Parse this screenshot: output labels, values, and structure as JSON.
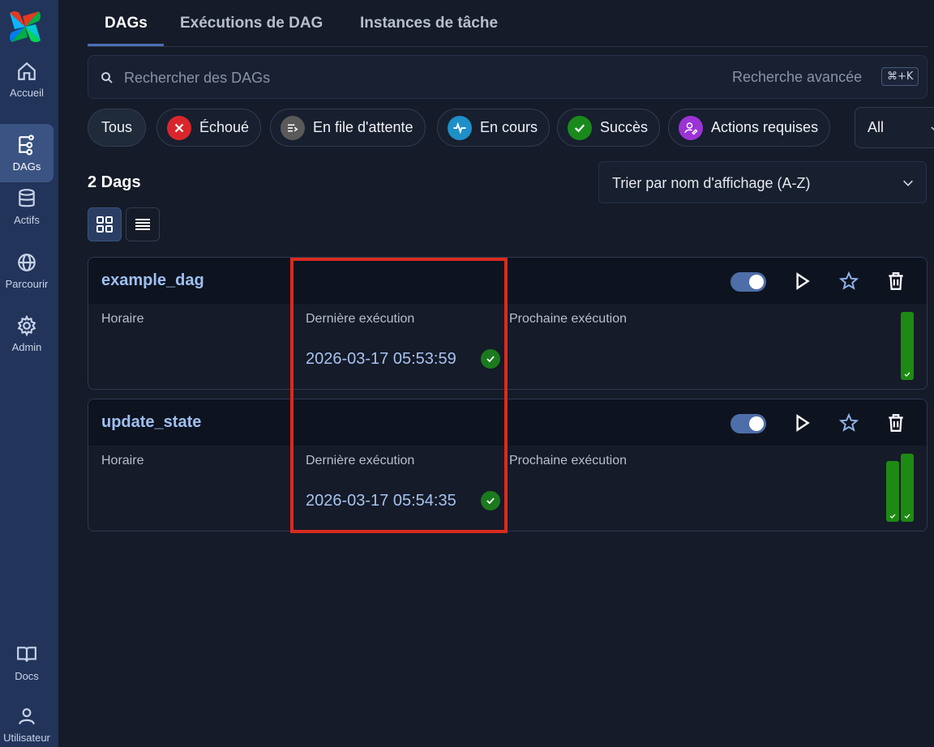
{
  "sidebar": {
    "items": [
      {
        "label": "Accueil",
        "icon": "home-icon"
      },
      {
        "label": "DAGs",
        "icon": "dags-icon",
        "active": true
      },
      {
        "label": "Actifs",
        "icon": "database-icon"
      },
      {
        "label": "Parcourir",
        "icon": "globe-icon"
      },
      {
        "label": "Admin",
        "icon": "gear-icon"
      },
      {
        "label": "Docs",
        "icon": "book-icon"
      },
      {
        "label": "Utilisateur",
        "icon": "user-icon"
      }
    ]
  },
  "tabs": [
    {
      "label": "DAGs",
      "active": true
    },
    {
      "label": "Exécutions de DAG"
    },
    {
      "label": "Instances de tâche"
    }
  ],
  "search": {
    "placeholder": "Rechercher des DAGs",
    "advanced_label": "Recherche avancée",
    "shortcut": "⌘+K"
  },
  "filters": {
    "all": "Tous",
    "failed": "Échoué",
    "queued": "En file d'attente",
    "running": "En cours",
    "success": "Succès",
    "actions": "Actions requises",
    "select_value": "All"
  },
  "list": {
    "count_label": "2 Dags",
    "sort_label": "Trier par nom d'affichage (A-Z)"
  },
  "colors": {
    "accent": "#4a6fb3",
    "success": "#1d8a13",
    "failed": "#d9262c",
    "running": "#1f8fc7",
    "actions": "#9b33d6",
    "highlight": "#d92b1f"
  },
  "dags": [
    {
      "name": "example_dag",
      "schedule_label": "Horaire",
      "last_run_label": "Dernière exécution",
      "next_run_label": "Prochaine exécution",
      "last_run": "2026-03-17 05:53:59",
      "last_run_status": "success",
      "paused": false,
      "recent_runs": [
        "success"
      ]
    },
    {
      "name": "update_state",
      "schedule_label": "Horaire",
      "last_run_label": "Dernière exécution",
      "next_run_label": "Prochaine exécution",
      "last_run": "2026-03-17 05:54:35",
      "last_run_status": "success",
      "paused": false,
      "recent_runs": [
        "success",
        "success"
      ]
    }
  ]
}
